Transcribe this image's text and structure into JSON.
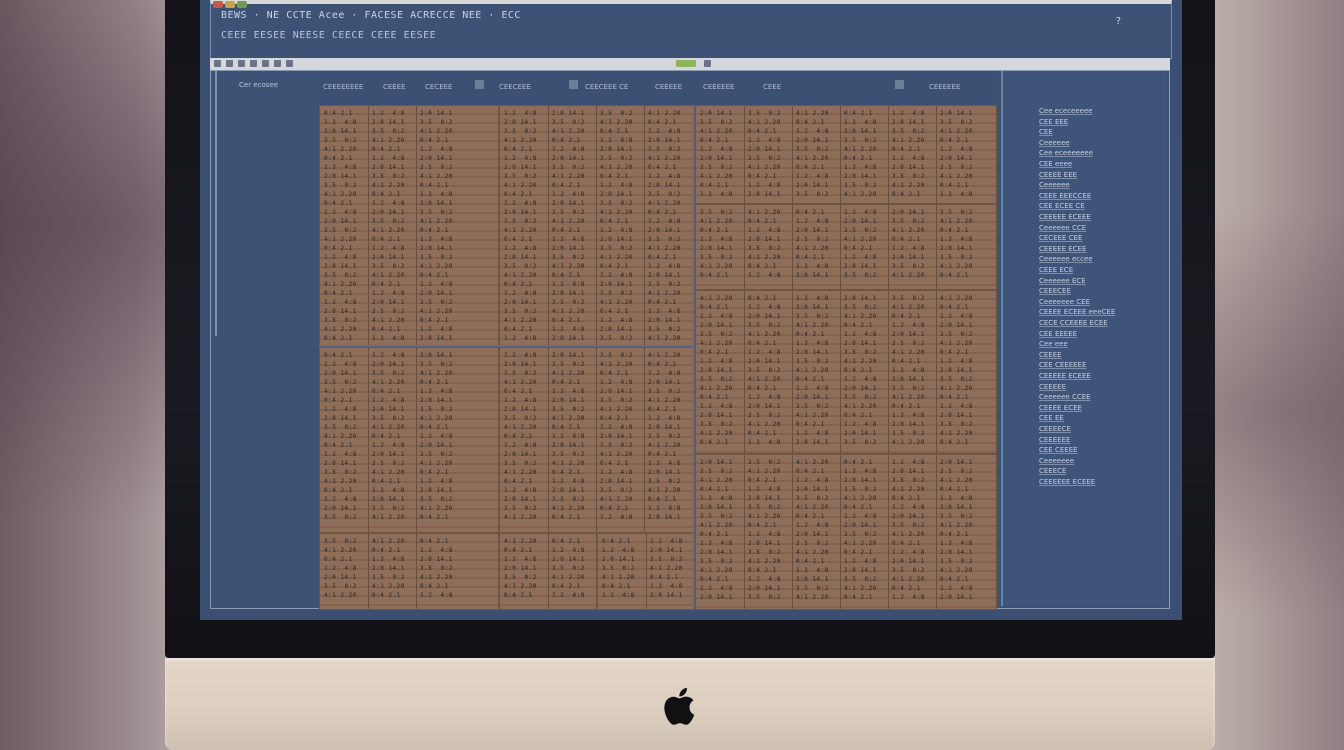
{
  "window": {
    "title_line_1": "BEWS · NE CCTE Acee · FACESE ACRECCE NEE · ECC",
    "title_line_2": "CEEE EESEE NEESE CEECE CEEE EESEE",
    "corner_mark": "?",
    "controls": [
      "close",
      "minimize",
      "zoom"
    ]
  },
  "sidebar": {
    "label": "Cer ecosee"
  },
  "grid": {
    "column_headers": [
      "CEEEEEEEE",
      "CEEEE",
      "CECEEE",
      "CEECEEE",
      "CEECEEE CE",
      "CEEEEE",
      "CEEEEEE",
      "CEEE",
      "CEEEEEE"
    ]
  },
  "right_panel": {
    "notes": [
      "Cee ececeeeee",
      "CEE EEE",
      "CEE",
      "Ceeeeee",
      "Cee eceeeeeee",
      "CEE eeee",
      "CEEEE EEE",
      "Ceeeeee",
      "CEEE EEECCEE",
      "CEE ECEE CE",
      "CEEEEE ECEEE",
      "Ceeeeee CCE",
      "CECEEE CEE",
      "CEEEEE ECEE",
      "Ceeeeee eccee",
      "CEEE ECE",
      "Ceeeeee ECE",
      "CEEECEE",
      "Ceeeeeee CEE",
      "CEEEE ECEEE eeeCEE",
      "CECE CCEEEE ECEE",
      "CEE EEEEE",
      "Cee eee",
      "CEEEE",
      "CEE CEEEEEE",
      "CEEEEE ECEEE",
      "CEEEEE",
      "Ceeeeee CCEE",
      "CEEEE ECEE",
      "CEE EE",
      "CEEEECE",
      "CEEEEEE",
      "CEE CEEEE",
      "Ceeeeeee",
      "CEEECE",
      "CEEEEEE ECEEE"
    ]
  },
  "colors": {
    "screen_bg": "#3a4f72",
    "grid_cell": "#8e6e58",
    "grid_line": "#5b6d8c",
    "bezel": "#15151b",
    "chin": "#dccfc0"
  },
  "icons": {
    "chin_logo": "apple-logo-icon"
  }
}
